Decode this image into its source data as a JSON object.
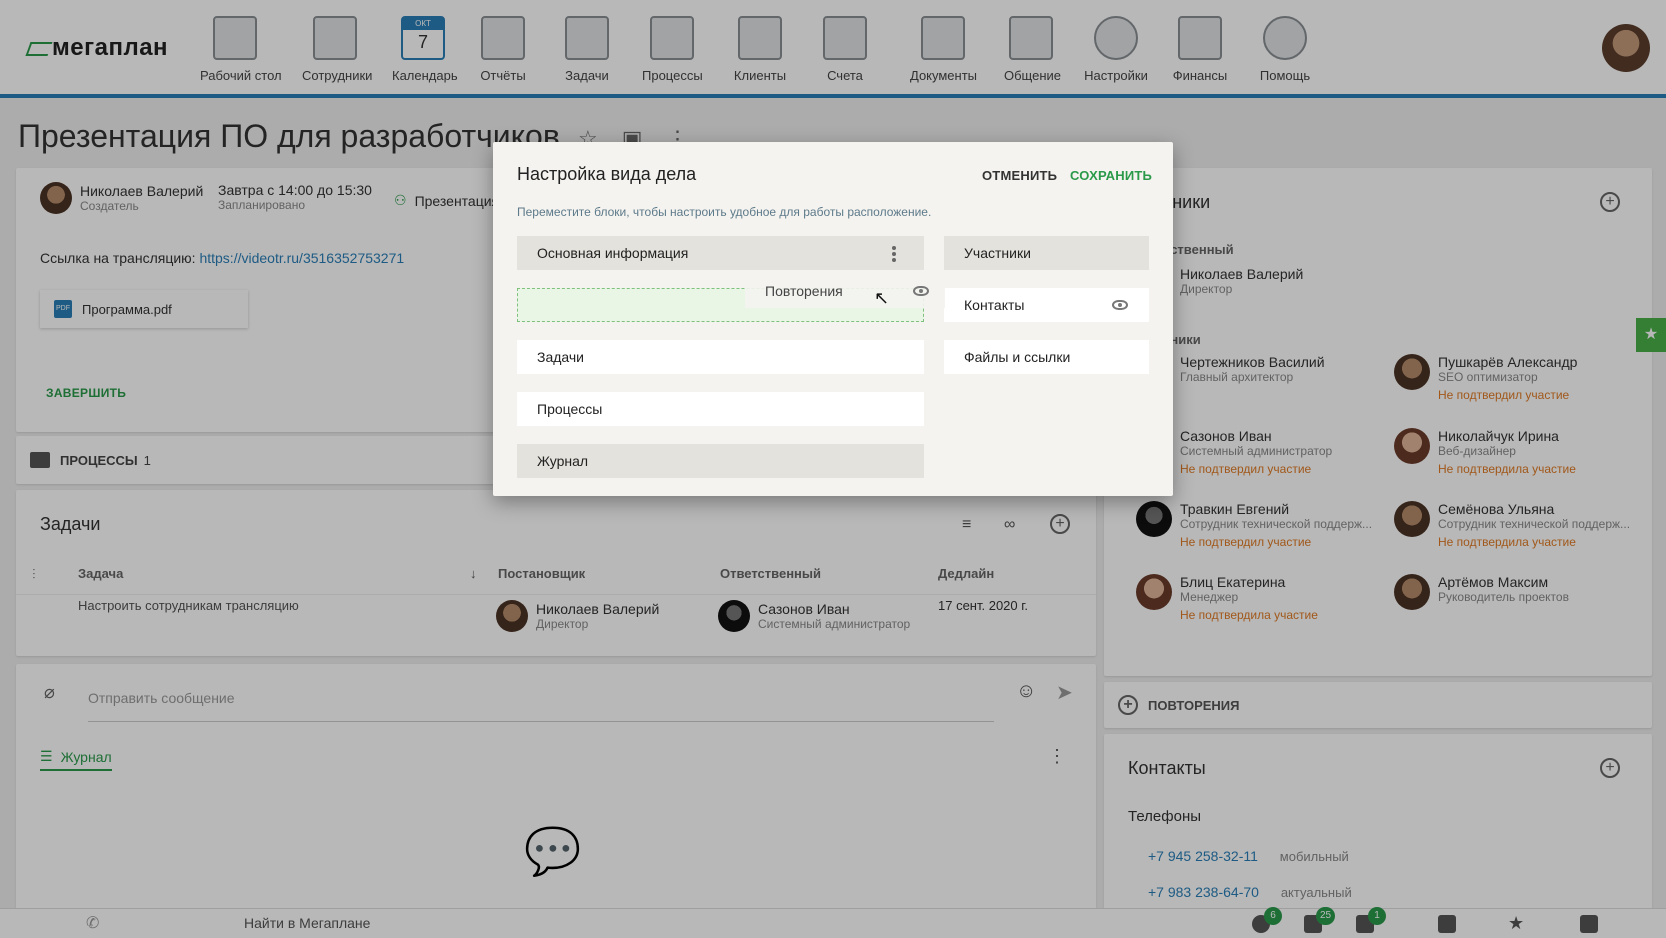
{
  "nav": {
    "logo": "мегаплан",
    "items": [
      {
        "label": "Рабочий стол",
        "icon": "desktop-icon"
      },
      {
        "label": "Сотрудники",
        "icon": "employees-icon"
      },
      {
        "label": "Календарь",
        "icon": "calendar-icon"
      },
      {
        "label": "Отчёты",
        "icon": "reports-icon"
      },
      {
        "label": "Задачи",
        "icon": "tasks-icon"
      },
      {
        "label": "Процессы",
        "icon": "processes-icon"
      },
      {
        "label": "Клиенты",
        "icon": "clients-icon"
      },
      {
        "label": "Счета",
        "icon": "invoices-icon"
      },
      {
        "label": "Документы",
        "icon": "documents-icon"
      },
      {
        "label": "Общение",
        "icon": "chat-icon"
      },
      {
        "label": "Настройки",
        "icon": "gear-icon"
      },
      {
        "label": "Финансы",
        "icon": "safe-icon"
      },
      {
        "label": "Помощь",
        "icon": "lifebuoy-icon"
      }
    ],
    "calendar_month": "ОКТ",
    "calendar_day": "7"
  },
  "page": {
    "title": "Презентация ПО для разработчиков"
  },
  "deal": {
    "creator_name": "Николаев Валерий",
    "creator_role": "Создатель",
    "schedule": "Завтра с 14:00 до 15:30",
    "schedule_status": "Запланировано",
    "group_label": "Презентация",
    "link_label": "Ссылка на трансляцию:",
    "link_url": "https://videotr.ru/3516352753271",
    "file_name": "Программа.pdf",
    "file_badge": "PDF",
    "finish_button": "ЗАВЕРШИТЬ"
  },
  "processes": {
    "label": "ПРОЦЕССЫ",
    "count": "1"
  },
  "tasks": {
    "title": "Задачи",
    "columns": [
      "Задача",
      "Постановщик",
      "Ответственный",
      "Дедлайн"
    ],
    "rows": [
      {
        "task": "Настроить сотрудникам трансляцию",
        "owner_name": "Николаев Валерий",
        "owner_role": "Директор",
        "resp_name": "Сазонов Иван",
        "resp_role": "Системный администратор",
        "deadline": "17 сент. 2020 г."
      }
    ]
  },
  "message": {
    "placeholder": "Отправить сообщение",
    "journal_tab": "Журнал"
  },
  "participants": {
    "title": "тники",
    "resp_label": "тственный",
    "resp_name": "Николаев Валерий",
    "resp_role": "Директор",
    "members_label": "тники",
    "members": [
      {
        "name": "Чертежников Василий",
        "role": "Главный архитектор",
        "status": ""
      },
      {
        "name": "Пушкарёв Александр",
        "role": "SEO оптимизатор",
        "status": "Не подтвердил участие"
      },
      {
        "name": "Сазонов Иван",
        "role": "Системный администратор",
        "status": "Не подтвердил участие"
      },
      {
        "name": "Николайчук Ирина",
        "role": "Веб-дизайнер",
        "status": "Не подтвердила участие"
      },
      {
        "name": "Травкин Евгений",
        "role": "Сотрудник технической поддерж...",
        "status": "Не подтвердил участие"
      },
      {
        "name": "Семёнова Ульяна",
        "role": "Сотрудник технической поддерж...",
        "status": "Не подтвердила участие"
      },
      {
        "name": "Блиц Екатерина",
        "role": "Менеджер",
        "status": "Не подтвердила участие"
      },
      {
        "name": "Артёмов Максим",
        "role": "Руководитель проектов",
        "status": ""
      }
    ]
  },
  "repeats": {
    "label": "ПОВТОРЕНИЯ"
  },
  "contacts": {
    "title": "Контакты",
    "phones_label": "Телефоны",
    "phones": [
      {
        "number": "+7 945 258-32-11",
        "type": "мобильный"
      },
      {
        "number": "+7 983 238-64-70",
        "type": "актуальный"
      }
    ]
  },
  "modal": {
    "title": "Настройка вида дела",
    "cancel": "ОТМЕНИТЬ",
    "save": "СОХРАНИТЬ",
    "hint": "Переместите блоки, чтобы настроить удобное для работы расположение.",
    "left_blocks": [
      "Основная информация",
      "Задачи",
      "Процессы",
      "Журнал"
    ],
    "right_blocks": [
      "Участники",
      "Контакты",
      "Файлы и ссылки"
    ],
    "dragging": "Повторения"
  },
  "bottom": {
    "search": "Найти в Мегаплане",
    "badges": [
      "6",
      "25",
      "1"
    ]
  }
}
